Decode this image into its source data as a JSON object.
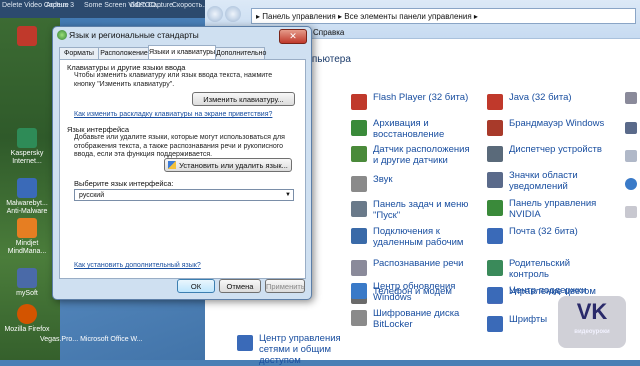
{
  "desktop": {
    "top_icons": [
      "Delete Video Capture",
      "Ardeus 3",
      "Some Screen Video Capture",
      "GOTOO...",
      "Скорость..."
    ],
    "icons": [
      {
        "label": "",
        "icon": "pdf-icon"
      },
      {
        "label": "Kaspersky Internet...",
        "icon": "kaspersky-icon"
      },
      {
        "label": "Malwarebyt... Anti-Malware",
        "icon": "malwarebytes-icon"
      },
      {
        "label": "Mindjet MindMana...",
        "icon": "mindjet-icon"
      },
      {
        "label": "mySoft",
        "icon": "mysoft-icon"
      },
      {
        "label": "Mozilla Firefox",
        "icon": "firefox-icon"
      }
    ],
    "bottom_labels": [
      "Vegas.Pro...",
      "Microsoft Office W..."
    ]
  },
  "control_panel": {
    "breadcrumb": [
      "Панель управления",
      "Все элементы панели управления"
    ],
    "menu": [
      "Справка"
    ],
    "subtitle": "мпьютера",
    "left_items": [
      {
        "label": "Flash Player (32 бита)",
        "icon": "flash-icon",
        "color": "#c0392b"
      },
      {
        "label": "Архивация и восстановление",
        "icon": "backup-icon",
        "color": "#3a8a3a"
      },
      {
        "label": "Датчик расположения и другие датчики",
        "icon": "sensor-icon",
        "color": "#4a8a3a"
      },
      {
        "label": "Звук",
        "icon": "sound-icon",
        "color": "#8a8a8a"
      },
      {
        "label": "Панель задач и меню \"Пуск\"",
        "icon": "taskbar-icon",
        "color": "#6a7a8a"
      },
      {
        "label": "Подключения к удаленным рабочим",
        "icon": "remote-icon",
        "color": "#3a6aa8"
      },
      {
        "label": "Распознавание речи",
        "icon": "microphone-icon",
        "color": "#8a8a9a"
      },
      {
        "label": "Телефон и модем",
        "icon": "phone-icon",
        "color": "#6a6a6a"
      },
      {
        "label": "Центр обновления Windows",
        "icon": "update-icon",
        "color": "#3a7ac8"
      },
      {
        "label": "Шифрование диска BitLocker",
        "icon": "bitlocker-icon",
        "color": "#8a8a8a"
      }
    ],
    "left_partial_items": [
      "Центр управления сетями и общим доступом"
    ],
    "right_items": [
      {
        "label": "Java (32 бита)",
        "icon": "java-icon",
        "color": "#c0392b"
      },
      {
        "label": "Брандмауэр Windows",
        "icon": "firewall-icon",
        "color": "#a83a2a"
      },
      {
        "label": "Диспетчер устройств",
        "icon": "device-manager-icon",
        "color": "#5a6a7a"
      },
      {
        "label": "Значки области уведомлений",
        "icon": "tray-icon",
        "color": "#5a6a8a"
      },
      {
        "label": "Панель управления NVIDIA",
        "icon": "nvidia-icon",
        "color": "#3a8a3a"
      },
      {
        "label": "Почта (32 бита)",
        "icon": "mail-icon",
        "color": "#3a6ab8"
      },
      {
        "label": "Родительский контроль",
        "icon": "parental-icon",
        "color": "#3a8a5a"
      },
      {
        "label": "Управление цветом",
        "icon": "color-icon",
        "color": "#4a6ab8"
      },
      {
        "label": "Центр поддержки",
        "icon": "flag-icon",
        "color": "#3a6ab8"
      },
      {
        "label": "Шрифты",
        "icon": "fonts-icon",
        "color": "#3a6ab8"
      }
    ]
  },
  "dialog": {
    "title": "Язык и региональные стандарты",
    "close": "✕",
    "tabs": [
      "Форматы",
      "Расположение",
      "Языки и клавиатуры",
      "Дополнительно"
    ],
    "active_tab": 2,
    "keyboards": {
      "title": "Клавиатуры и другие языки ввода",
      "text": "Чтобы изменить клавиатуру или язык ввода текста, нажмите кнопку \"Изменить клавиатуру\".",
      "button": "Изменить клавиатуру...",
      "link": "Как изменить раскладку клавиатуры на экране приветствия?"
    },
    "interface": {
      "title": "Язык интерфейса",
      "text": "Добавьте или удалите языки, которые могут использоваться для отображения текста, а также распознавания речи и рукописного ввода, если эта функция поддерживается.",
      "button": "Установить или удалить язык...",
      "select_label": "Выберите язык интерфейса:",
      "select_value": "русский"
    },
    "bottom_link": "Как установить дополнительный язык?",
    "buttons": {
      "ok": "ОК",
      "cancel": "Отмена",
      "apply": "Применить"
    }
  },
  "watermark": {
    "logo": "VK",
    "caption": "видеоуроки"
  }
}
